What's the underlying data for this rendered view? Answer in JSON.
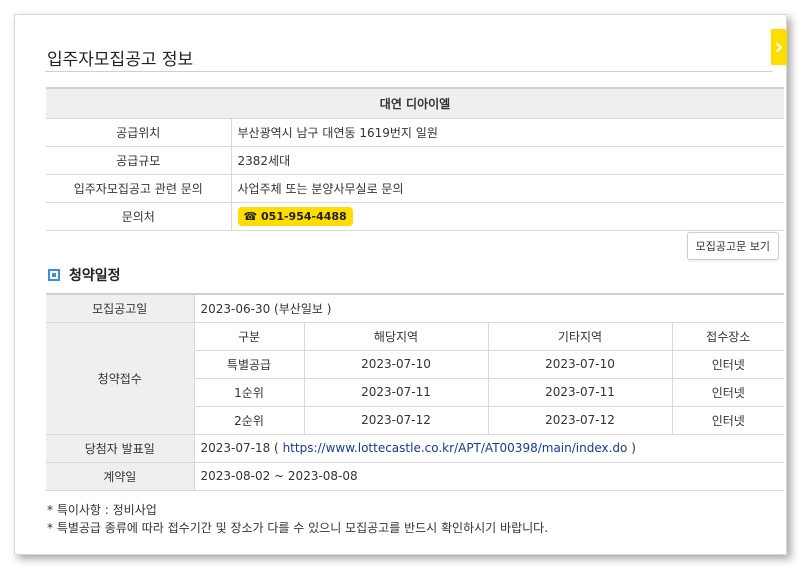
{
  "title": "입주자모집공고 정보",
  "close_glyph": "›",
  "info": {
    "heading": "대연 디아이엘",
    "rows": [
      {
        "label": "공급위치",
        "value": "부산광역시 남구 대연동 1619번지 일원"
      },
      {
        "label": "공급규모",
        "value": "2382세대"
      },
      {
        "label": "입주자모집공고 관련 문의",
        "value": "사업주체 또는 분양사무실로 문의"
      }
    ],
    "contact_label": "문의처",
    "phone": "☎ 051-954-4488"
  },
  "notice_button": "모집공고문 보기",
  "section_title": "청약일정",
  "schedule": {
    "announce_label": "모집공고일",
    "announce_value": "2023-06-30 (부산일보 )",
    "reception_label": "청약접수",
    "columns": [
      "구분",
      "해당지역",
      "기타지역",
      "접수장소"
    ],
    "rows": [
      [
        "특별공급",
        "2023-07-10",
        "2023-07-10",
        "인터넷"
      ],
      [
        "1순위",
        "2023-07-11",
        "2023-07-11",
        "인터넷"
      ],
      [
        "2순위",
        "2023-07-12",
        "2023-07-12",
        "인터넷"
      ]
    ],
    "winner_label": "당첨자 발표일",
    "winner_date": "2023-07-18 (",
    "winner_link": "https://www.lottecastle.co.kr/APT/AT00398/main/index.do",
    "winner_close": ")",
    "contract_label": "계약일",
    "contract_value": "2023-08-02 ~ 2023-08-08"
  },
  "notes": [
    "* 특이사항 : 정비사업",
    "* 특별공급 종류에 따라 접수기간 및 장소가 다를 수 있으니 모집공고를 반드시 확인하시기 바랍니다."
  ]
}
